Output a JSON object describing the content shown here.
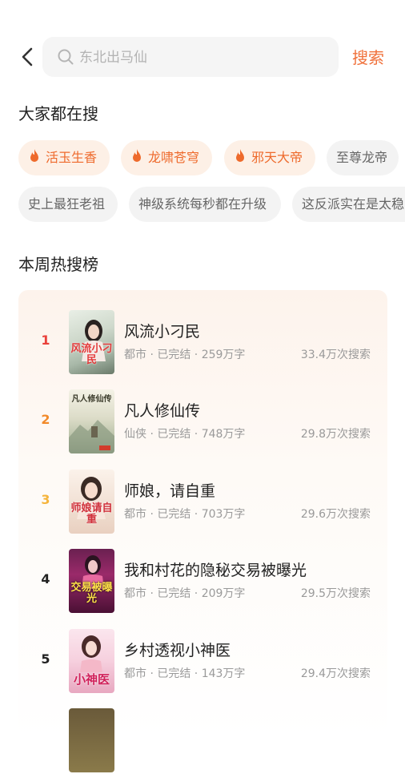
{
  "search": {
    "placeholder": "东北出马仙",
    "button_label": "搜索"
  },
  "trending": {
    "title": "大家都在搜",
    "tags": [
      {
        "label": "活玉生香",
        "hot": true
      },
      {
        "label": "龙啸苍穹",
        "hot": true
      },
      {
        "label": "邪天大帝",
        "hot": true
      },
      {
        "label": "至尊龙帝",
        "hot": false
      },
      {
        "label": "史上最狂老祖",
        "hot": false
      },
      {
        "label": "神级系统每秒都在升级",
        "hot": false
      },
      {
        "label": "这反派实在是太稳",
        "hot": false
      }
    ]
  },
  "weekly": {
    "title": "本周热搜榜",
    "books": [
      {
        "rank": "1",
        "title": "风流小刁民",
        "meta": "都市 · 已完结 · 259万字",
        "searches": "33.4万次搜索",
        "cover_text": "风流小刁民"
      },
      {
        "rank": "2",
        "title": "凡人修仙传",
        "meta": "仙侠 · 已完结 · 748万字",
        "searches": "29.8万次搜索",
        "cover_text": "凡人修仙传"
      },
      {
        "rank": "3",
        "title": "师娘，请自重",
        "meta": "都市 · 已完结 · 703万字",
        "searches": "29.6万次搜索",
        "cover_text": "师娘请自重"
      },
      {
        "rank": "4",
        "title": "我和村花的隐秘交易被曝光",
        "meta": "都市 · 已完结 · 209万字",
        "searches": "29.5万次搜索",
        "cover_text": "交易被曝光"
      },
      {
        "rank": "5",
        "title": "乡村透视小神医",
        "meta": "都市 · 已完结 · 143万字",
        "searches": "29.4万次搜索",
        "cover_text": "小神医"
      }
    ]
  },
  "colors": {
    "accent": "#f0703a",
    "rank1": "#e9403a",
    "rank2": "#f28a2a",
    "rank3": "#f5b43c",
    "rank_other": "#222222"
  }
}
